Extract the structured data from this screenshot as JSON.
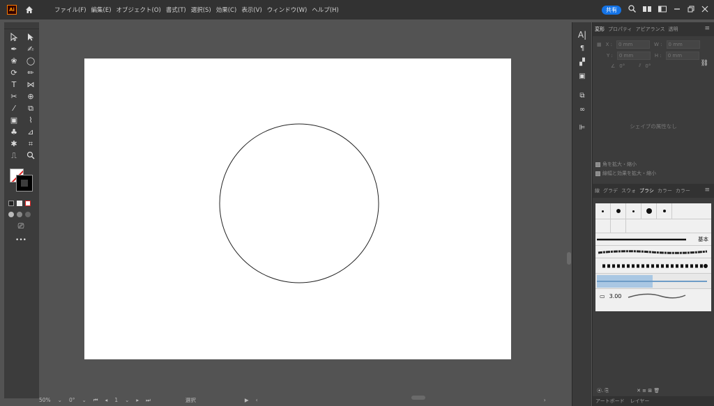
{
  "menubar": {
    "logo": "Ai",
    "items": [
      "ファイル(F)",
      "編集(E)",
      "オブジェクト(O)",
      "書式(T)",
      "選択(S)",
      "効果(C)",
      "表示(V)",
      "ウィンドウ(W)",
      "ヘルプ(H)"
    ],
    "share": "共有"
  },
  "statusbar": {
    "zoom": "50%",
    "rotate": "0°",
    "artboard_num": "1",
    "tool": "選択"
  },
  "panel": {
    "tabs": [
      "変形",
      "プロパティ",
      "アピアランス",
      "透明"
    ],
    "x_label": "X :",
    "y_label": "Y :",
    "w_label": "W :",
    "h_label": "H :",
    "x_value": "0 mm",
    "y_value": "0 mm",
    "w_value": "0 mm",
    "h_value": "0 mm",
    "angle_value": "0°",
    "shear_value": "0°",
    "no_shape": "シェイプの属性なし",
    "scale_corners": "角を拡大・縮小",
    "scale_strokes": "線幅と効果を拡大・縮小",
    "brush_tabs": [
      "線",
      "グラデ",
      "スウォ",
      "ブラシ",
      "カラー",
      "カラー"
    ],
    "basic_label": "基本",
    "stroke_value": "3.00",
    "bottom_tabs": [
      "アートボード",
      "レイヤー"
    ]
  },
  "icons": {
    "home": "home-icon",
    "search": "search-icon"
  }
}
